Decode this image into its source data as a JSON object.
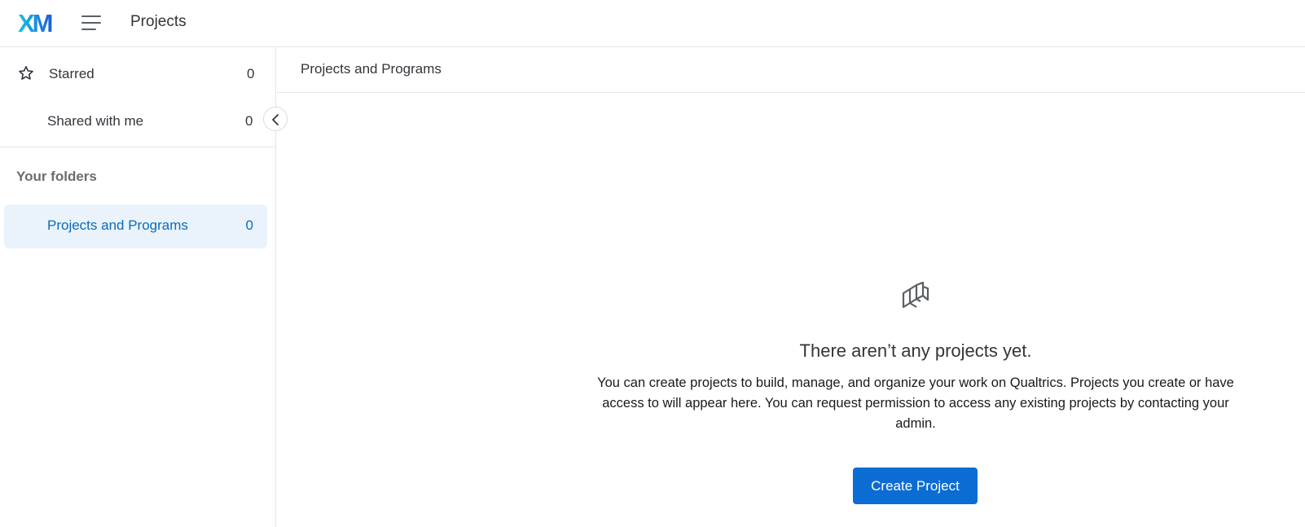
{
  "header": {
    "logo_text": "XM",
    "app_title": "Projects",
    "colors": {
      "logo_gradient_start": "#19c2e5",
      "logo_gradient_end": "#1a5fd6"
    }
  },
  "sidebar": {
    "items": [
      {
        "label": "Starred",
        "count": "0",
        "icon": "star-icon"
      },
      {
        "label": "Shared with me",
        "count": "0"
      }
    ],
    "section_title": "Your folders",
    "folders": [
      {
        "label": "Projects and Programs",
        "count": "0",
        "selected": true
      }
    ],
    "collapse_icon": "chevron-left-icon"
  },
  "main": {
    "breadcrumb": "Projects and Programs",
    "empty_state": {
      "icon": "projects-stack-icon",
      "title": "There aren’t any projects yet.",
      "description": "You can create projects to build, manage, and organize your work on Qualtrics. Projects you create or have access to will appear here. You can request permission to access any existing projects by contacting your admin.",
      "button_label": "Create Project"
    }
  },
  "colors": {
    "accent": "#0b6cd4",
    "selected_bg": "#eaf3fb",
    "selected_text": "#0b6bb8",
    "border": "#e4e6ea"
  }
}
